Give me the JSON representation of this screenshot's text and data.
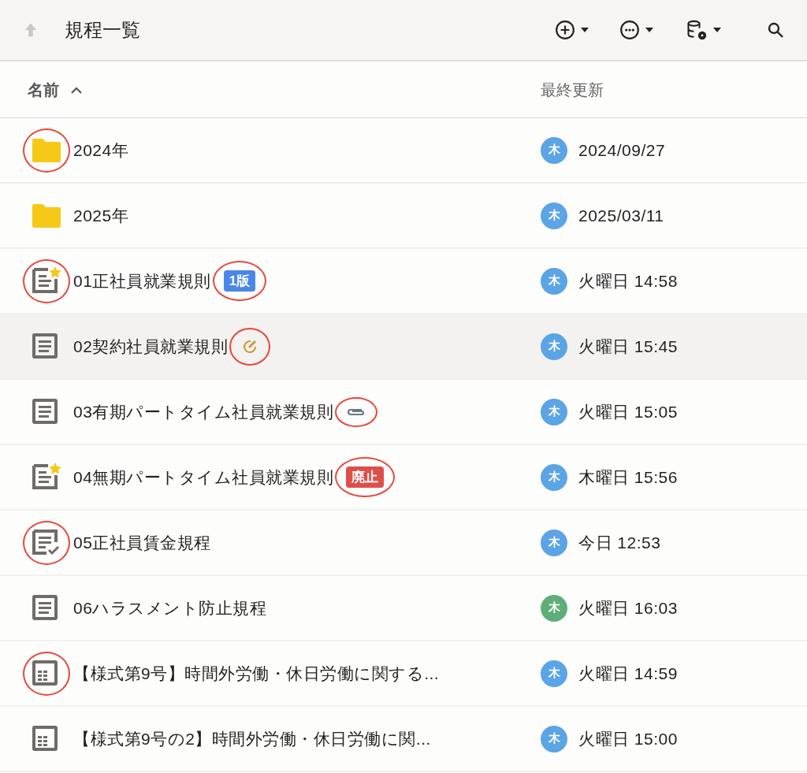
{
  "toolbar": {
    "title": "規程一覧"
  },
  "columns": [
    {
      "label": "名前",
      "sorted_ascending": true
    },
    {
      "label": "最終更新"
    }
  ],
  "rows": [
    {
      "kind": "folder",
      "name": "2024年",
      "highlighted": false,
      "circled_icon": true,
      "avatar": "木",
      "color": "#5ba4e5",
      "updated": "2024/09/27"
    },
    {
      "kind": "folder",
      "name": "2025年",
      "highlighted": false,
      "circled_icon": false,
      "avatar": "木",
      "color": "#5ba4e5",
      "updated": "2025/03/11"
    },
    {
      "kind": "document",
      "starred": true,
      "approved": false,
      "name": "01正社員就業規則",
      "highlighted": false,
      "circled_icon": true,
      "badge": {
        "kind": "version",
        "text": "1版",
        "circled": true
      },
      "avatar": "木",
      "color": "#5ba4e5",
      "updated": "火曜日 14:58"
    },
    {
      "kind": "document",
      "starred": false,
      "approved": false,
      "name": "02契約社員就業規則",
      "highlighted": true,
      "circled_icon": false,
      "badge": {
        "kind": "editing",
        "circled": true
      },
      "avatar": "木",
      "color": "#5ba4e5",
      "updated": "火曜日 15:45"
    },
    {
      "kind": "document",
      "starred": false,
      "approved": false,
      "name": "03有期パートタイム社員就業規則",
      "highlighted": false,
      "circled_icon": false,
      "badge": {
        "kind": "attachment",
        "circled": true
      },
      "avatar": "木",
      "color": "#5ba4e5",
      "updated": "火曜日 15:05"
    },
    {
      "kind": "document",
      "starred": true,
      "approved": false,
      "name": "04無期パートタイム社員就業規則",
      "highlighted": false,
      "circled_icon": false,
      "badge": {
        "kind": "abolished",
        "text": "廃止",
        "circled": true
      },
      "avatar": "木",
      "color": "#5ba4e5",
      "updated": "木曜日 15:56"
    },
    {
      "kind": "document",
      "starred": false,
      "approved": true,
      "name": "05正社員賃金規程",
      "highlighted": false,
      "circled_icon": true,
      "avatar": "木",
      "color": "#5ba4e5",
      "updated": "今日 12:53"
    },
    {
      "kind": "document",
      "starred": false,
      "approved": false,
      "name": "06ハラスメント防止規程",
      "highlighted": false,
      "circled_icon": false,
      "avatar": "木",
      "color": "#5fae7a",
      "updated": "火曜日 16:03"
    },
    {
      "kind": "form",
      "name": "【様式第9号】時間外労働・休日労働に関する...",
      "highlighted": false,
      "circled_icon": true,
      "avatar": "木",
      "color": "#5ba4e5",
      "updated": "火曜日 14:59"
    },
    {
      "kind": "form",
      "name": "【様式第9号の2】時間外労働・休日労働に関...",
      "highlighted": false,
      "circled_icon": false,
      "avatar": "木",
      "color": "#5ba4e5",
      "updated": "火曜日 15:00"
    }
  ]
}
